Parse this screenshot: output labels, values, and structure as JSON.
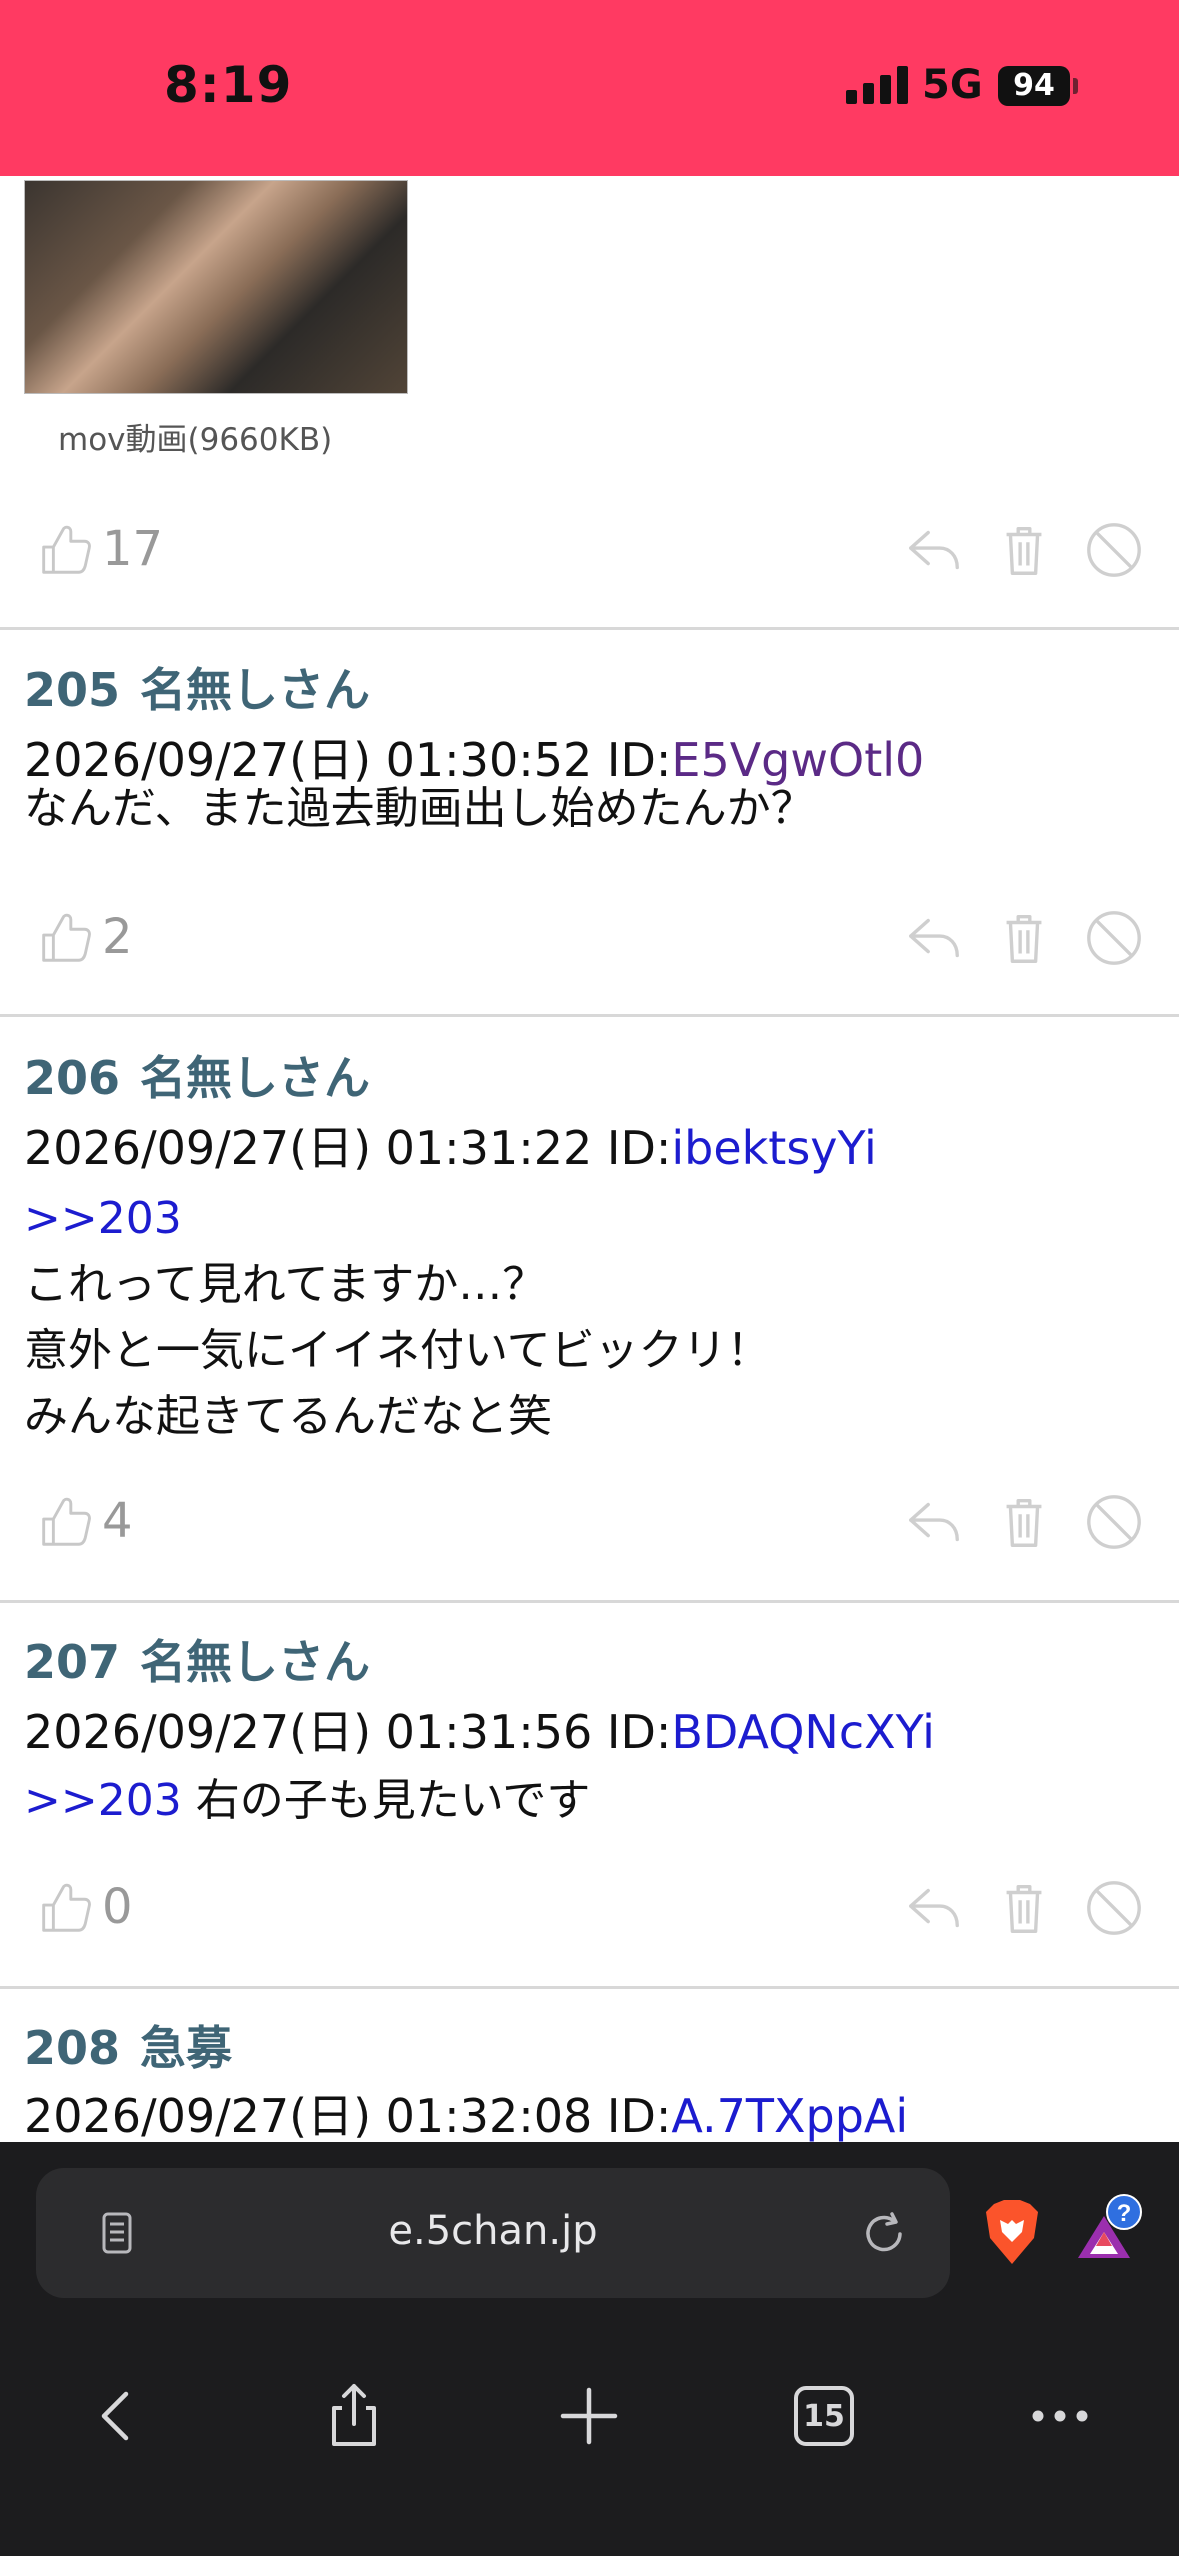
{
  "status": {
    "time": "8:19",
    "network": "5G",
    "battery": "94"
  },
  "media": {
    "caption": "mov動画(9660KB)",
    "likes": "17"
  },
  "posts": [
    {
      "number": "205",
      "name": "名無しさん",
      "date": "2026/09/27(日) 01:30:52",
      "id_label": "ID:",
      "id": "E5VgwOtl0",
      "anchor": "",
      "lines": [
        "なんだ、また過去動画出し始めたんか？"
      ],
      "likes": "2"
    },
    {
      "number": "206",
      "name": "名無しさん",
      "date": "2026/09/27(日) 01:31:22",
      "id_label": "ID:",
      "id": "ibektsyYi",
      "anchor": ">>203",
      "lines": [
        "これって見れてますか…？",
        "意外と一気にイイネ付いてビックリ！",
        "みんな起きてるんだなと笑"
      ],
      "likes": "4"
    },
    {
      "number": "207",
      "name": "名無しさん",
      "date": "2026/09/27(日) 01:31:56",
      "id_label": "ID:",
      "id": "BDAQNcXYi",
      "anchor": ">>203",
      "inline_text": " 右の子も見たいです",
      "likes": "0"
    },
    {
      "number": "208",
      "name": "急募",
      "date": "2026/09/27(日) 01:32:08",
      "id_label": "ID:",
      "id": "A.7TXppAi"
    }
  ],
  "browser": {
    "url": "e.5chan.jp",
    "tab_count": "15",
    "rewards_badge": "?"
  },
  "colors": {
    "status_bar": "#ff3a62",
    "post_header": "#3f6576",
    "link": "#1c1ccf",
    "visited_link": "#5b2a86",
    "browser_bg": "#1c1c1e"
  }
}
